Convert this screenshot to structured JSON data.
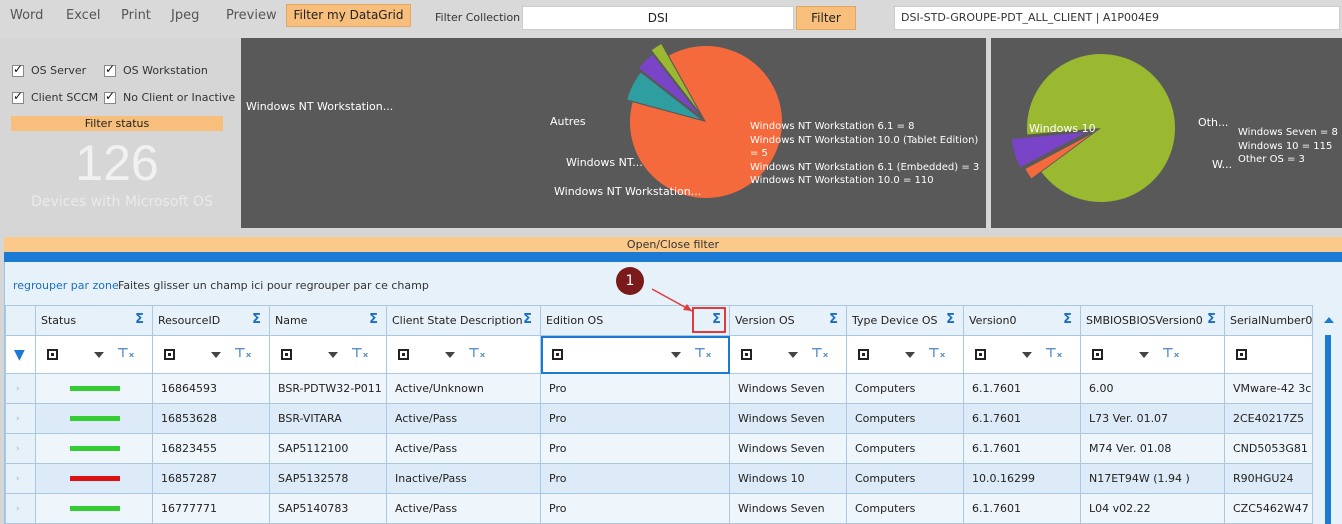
{
  "menu": {
    "word": "Word",
    "excel": "Excel",
    "print": "Print",
    "jpeg": "Jpeg",
    "preview": "Preview",
    "filter_grid": "Filter my DataGrid"
  },
  "filter_collection": {
    "label": "Filter Collection :",
    "value": "DSI",
    "button": "Filter",
    "collection": "DSI-STD-GROUPE-PDT_ALL_CLIENT  |  A1P004E9"
  },
  "left_panel": {
    "checkboxes": [
      "OS Server",
      "OS Workstation",
      "Client SCCM",
      "No Client or Inactive"
    ],
    "filter_status": "Filter status",
    "count": "126",
    "caption": "Devices with Microsoft OS"
  },
  "colors": {
    "accent": "#1a7ad4",
    "orange_button": "#f7bf7b",
    "status_ok": "#33cc33",
    "status_bad": "#dd1111",
    "pie1_main": "#f56a3c",
    "pie1_teal": "#2e9ea0",
    "pie1_purple": "#7a44c8",
    "pie1_green": "#9ab830",
    "pie2_main": "#9ab830",
    "pie2_orange": "#f56a3c",
    "pie2_purple": "#7a44c8"
  },
  "chart_data": [
    {
      "type": "pie",
      "slices": [
        {
          "label": "Windows NT Workstation...",
          "value": 110
        },
        {
          "label": "Autres",
          "value": 8
        },
        {
          "label": "Windows NT...",
          "value": 5
        },
        {
          "label": "Windows NT Workstation...",
          "value": 3
        }
      ],
      "legend": [
        "Windows NT Workstation 6.1 = 8",
        "Windows NT Workstation 10.0 (Tablet Edition) = 5",
        "Windows NT Workstation 6.1 (Embedded) = 3",
        "Windows NT Workstation 10.0 = 110"
      ]
    },
    {
      "type": "pie",
      "slices": [
        {
          "label": "Windows 10",
          "value": 115
        },
        {
          "label": "Oth...",
          "value": 3
        },
        {
          "label": "W...",
          "value": 8
        }
      ],
      "legend": [
        "Windows Seven = 8",
        "Windows 10 = 115",
        "Other OS = 3"
      ]
    }
  ],
  "open_close": "Open/Close filter",
  "group": {
    "title": "regrouper par zone",
    "hint": "Faites glisser un champ ici pour regrouper par ce champ"
  },
  "columns": [
    "Status",
    "ResourceID",
    "Name",
    "Client State Description",
    "Edition OS",
    "Version OS",
    "Type Device OS",
    "Version0",
    "SMBIOSBIOSVersion0",
    "SerialNumber0"
  ],
  "rows": [
    {
      "status": "ok",
      "resource_id": "16864593",
      "name": "BSR-PDTW32-P011",
      "client_state": "Active/Unknown",
      "edition": "Pro",
      "version_os": "Windows Seven",
      "type": "Computers",
      "version0": "6.1.7601",
      "bios": "6.00",
      "serial": "VMware-42 3c"
    },
    {
      "status": "ok",
      "resource_id": "16853628",
      "name": "BSR-VITARA",
      "client_state": "Active/Pass",
      "edition": "Pro",
      "version_os": "Windows Seven",
      "type": "Computers",
      "version0": "6.1.7601",
      "bios": "L73 Ver. 01.07",
      "serial": "2CE40217Z5"
    },
    {
      "status": "ok",
      "resource_id": "16823455",
      "name": "SAP5112100",
      "client_state": "Active/Pass",
      "edition": "Pro",
      "version_os": "Windows Seven",
      "type": "Computers",
      "version0": "6.1.7601",
      "bios": "M74 Ver. 01.08",
      "serial": "CND5053G81"
    },
    {
      "status": "bad",
      "resource_id": "16857287",
      "name": "SAP5132578",
      "client_state": "Inactive/Pass",
      "edition": "Pro",
      "version_os": "Windows 10",
      "type": "Computers",
      "version0": "10.0.16299",
      "bios": "N17ET94W (1.94 )",
      "serial": "R90HGU24"
    },
    {
      "status": "ok",
      "resource_id": "16777771",
      "name": "SAP5140783",
      "client_state": "Active/Pass",
      "edition": "Pro",
      "version_os": "Windows Seven",
      "type": "Computers",
      "version0": "6.1.7601",
      "bios": "L04 v02.22",
      "serial": "CZC5462W47"
    }
  ],
  "annotation": "1"
}
